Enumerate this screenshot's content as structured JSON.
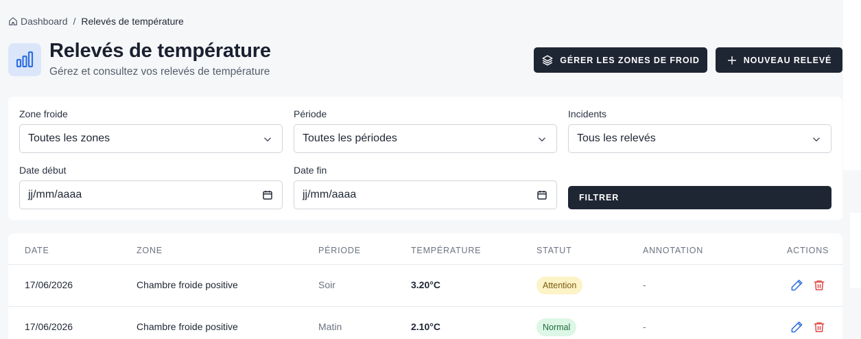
{
  "breadcrumb": {
    "home_label": "Dashboard",
    "separator": "/",
    "current": "Relevés de température"
  },
  "header": {
    "title": "Relevés de température",
    "subtitle": "Gérez et consultez vos relevés de température",
    "icon": "bar-chart-icon"
  },
  "toolbar": {
    "zones_button": "GÉRER LES ZONES DE FROID",
    "new_button": "NOUVEAU RELEVÉ"
  },
  "filters": {
    "zone": {
      "label": "Zone froide",
      "value": "Toutes les zones"
    },
    "period": {
      "label": "Période",
      "value": "Toutes les périodes"
    },
    "incidents": {
      "label": "Incidents",
      "value": "Tous les relevés"
    },
    "date_start": {
      "label": "Date début",
      "value": "jj/mm/aaaa"
    },
    "date_end": {
      "label": "Date fin",
      "value": "jj/mm/aaaa"
    },
    "submit": "FILTRER"
  },
  "table": {
    "columns": [
      "DATE",
      "ZONE",
      "PÉRIODE",
      "TEMPÉRATURE",
      "STATUT",
      "ANNOTATION",
      "ACTIONS"
    ],
    "rows": [
      {
        "date": "17/06/2026",
        "zone": "Chambre froide positive",
        "period": "Soir",
        "temperature": "3.20°C",
        "status": "Attention",
        "annotation": "-"
      },
      {
        "date": "17/06/2026",
        "zone": "Chambre froide positive",
        "period": "Matin",
        "temperature": "2.10°C",
        "status": "Normal",
        "annotation": "-"
      }
    ]
  },
  "colors": {
    "primary_dark": "#1e2533",
    "accent_blue": "#2f6fde",
    "delete_red": "#e04848",
    "warn_bg": "#fcf3c6",
    "ok_bg": "#dcf7e5"
  }
}
